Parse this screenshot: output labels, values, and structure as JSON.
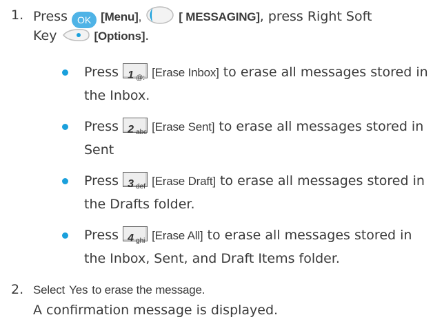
{
  "steps": [
    {
      "number": "1.",
      "press": "Press",
      "ok_label": "OK",
      "menu": "[Menu]",
      "comma": ",",
      "messaging": "[ MESSAGING]",
      "press_right": ", press Right Soft",
      "key": "Key",
      "options": "[Options]",
      "period": "."
    },
    {
      "number": "2.",
      "line1_select": "Select",
      "line1_yes": "Yes",
      "line1_rest": "to erase the message.",
      "line2": "A confirmation message is displayed."
    }
  ],
  "bullets": [
    {
      "press": "Press",
      "key_num": "1",
      "key_sym": "@:",
      "label": "[Erase Inbox]",
      "text1": "to erase all messages stored in",
      "text2": "the Inbox."
    },
    {
      "press": "Press",
      "key_num": "2",
      "key_sym": "abc",
      "label": "[Erase Sent]",
      "text1": "to erase all messages stored in",
      "text2": "Sent"
    },
    {
      "press": "Press",
      "key_num": "3",
      "key_sym": "def",
      "label": "[Erase Draft]",
      "text1": "to erase all messages stored in",
      "text2": "the Drafts folder."
    },
    {
      "press": "Press",
      "key_num": "4",
      "key_sym": "ghi",
      "label": "[Erase All]",
      "text1": "to erase all messages stored in",
      "text2": "the Inbox, Sent, and Draft Items folder."
    }
  ],
  "colors": {
    "accent": "#1aa0dc",
    "ok_button": "#4fb3e6",
    "text": "#3a3a3a"
  },
  "icons": [
    "ok-button-icon",
    "nav-key-icon",
    "right-soft-key-icon",
    "keypad-key-icon"
  ]
}
